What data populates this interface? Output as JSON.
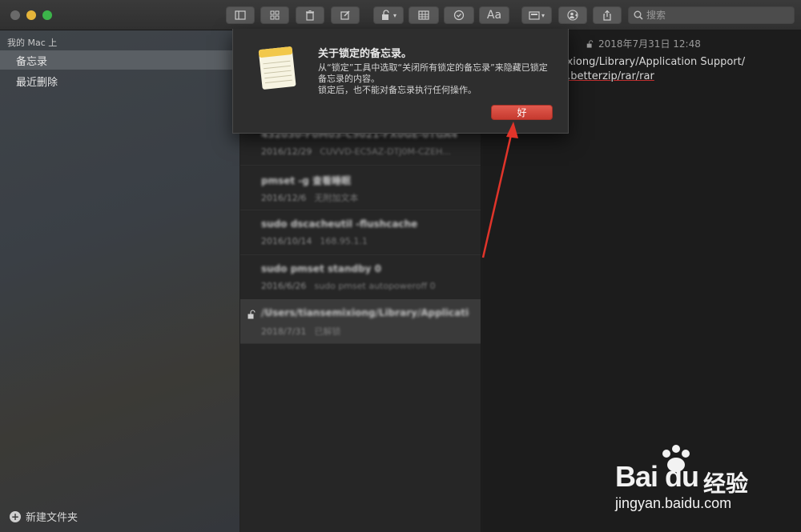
{
  "search": {
    "placeholder": "搜索"
  },
  "sidebar": {
    "section": "我的 Mac 上",
    "items": [
      {
        "label": "备忘录",
        "selected": true
      },
      {
        "label": "最近删除",
        "selected": false
      }
    ],
    "new_folder": "新建文件夹"
  },
  "notes": [
    {
      "title": "432030-F0M03-C9021-FX0GE-0TGA4",
      "date": "2016/12/29",
      "preview": "CUVVD-EC5AZ-DTJ0M-CZEH..."
    },
    {
      "title": "pmset -g 查看睡眠",
      "date": "2016/12/6",
      "preview": "无附加文本"
    },
    {
      "title": "sudo dscacheutil -flushcache",
      "date": "2016/10/14",
      "preview": "168.95.1.1"
    },
    {
      "title": "sudo pmset standby 0",
      "date": "2016/6/26",
      "preview": "sudo pmset autopoweroff 0"
    },
    {
      "title": "/Users/tiansemixiong/Library/Applicatio...",
      "date": "2018/7/31",
      "preview": "已解锁"
    }
  ],
  "editor": {
    "date": "2018年7月31日 12:48",
    "line1": "ixiong/Library/Application Support/",
    "line2": "r.betterzip/rar/rar"
  },
  "dialog": {
    "title": "关于锁定的备忘录。",
    "line1": "从“锁定”工具中选取“关闭所有锁定的备忘录”来隐藏已锁定",
    "line2": "备忘录的内容。",
    "line3": "锁定后，也不能对备忘录执行任何操作。",
    "ok": "好"
  },
  "watermark": {
    "logo": "Bai du",
    "brand": "经验",
    "url": "jingyan.baidu.com"
  },
  "colors": {
    "ok_button": "#d4473b",
    "arrow": "#e0342a"
  }
}
